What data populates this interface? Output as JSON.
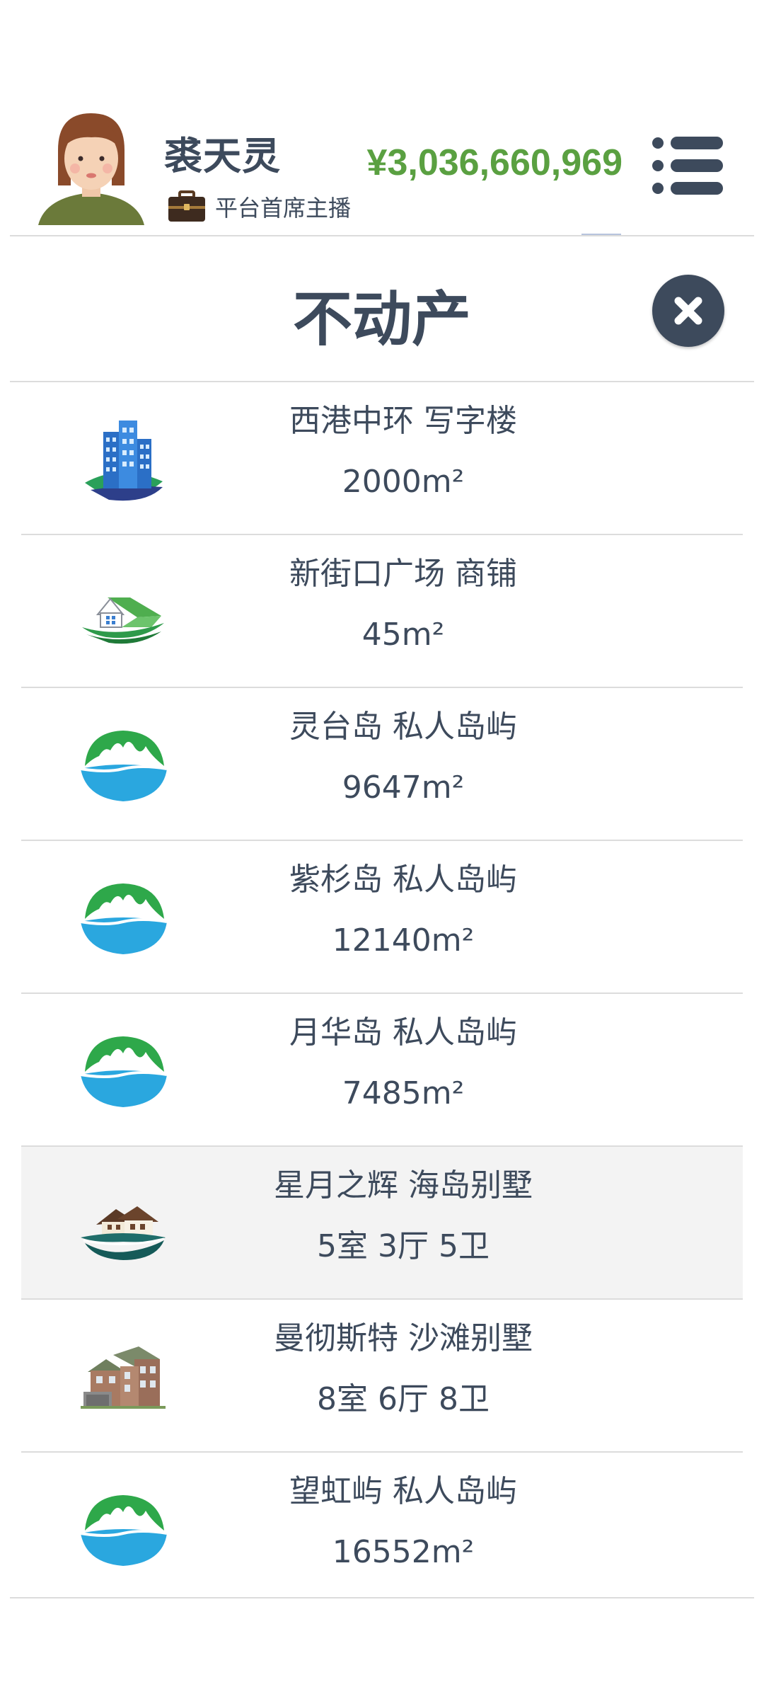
{
  "header": {
    "user_name": "裘天灵",
    "user_title": "平台首席主播",
    "balance": "¥3,036,660,969",
    "avatar_icon": "female-avatar-icon",
    "title_icon": "briefcase-icon",
    "menu_icon": "list-menu-icon"
  },
  "panel": {
    "title": "不动产",
    "close_icon": "close-icon"
  },
  "properties": [
    {
      "name": "西港中环 写字楼",
      "detail": "2000m²",
      "icon": "office-building-icon"
    },
    {
      "name": "新街口广场 商铺",
      "detail": "45m²",
      "icon": "shop-house-icon"
    },
    {
      "name": "灵台岛 私人岛屿",
      "detail": "9647m²",
      "icon": "island-icon"
    },
    {
      "name": "紫杉岛 私人岛屿",
      "detail": "12140m²",
      "icon": "island-icon"
    },
    {
      "name": "月华岛 私人岛屿",
      "detail": "7485m²",
      "icon": "island-icon"
    },
    {
      "name": "星月之辉 海岛别墅",
      "detail": "5室 3厅 5卫",
      "icon": "island-villa-icon"
    },
    {
      "name": "曼彻斯特 沙滩别墅",
      "detail": "8室 6厅 8卫",
      "icon": "beach-villa-icon"
    },
    {
      "name": "望虹屿 私人岛屿",
      "detail": "16552m²",
      "icon": "island-icon"
    }
  ],
  "colors": {
    "text": "#3d4a5c",
    "balance": "#5aa041",
    "highlight_row": "#f3f3f3",
    "divider": "#dcdcdc"
  }
}
